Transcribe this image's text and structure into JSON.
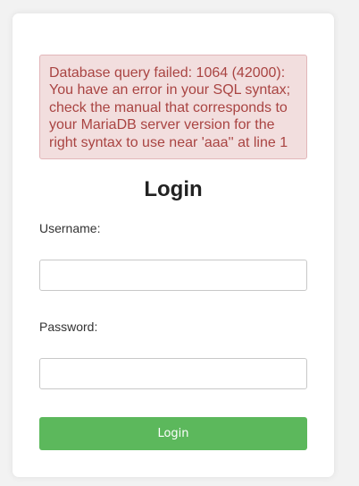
{
  "error_message": "Database query failed: 1064 (42000): You have an error in your SQL syntax; check the manual that corresponds to your MariaDB server version for the right syntax to use near 'aaa'' at line 1",
  "form": {
    "title": "Login",
    "username_label": "Username:",
    "username_value": "",
    "password_label": "Password:",
    "password_value": "",
    "submit_label": "Login"
  },
  "colors": {
    "error_background": "#f2dede",
    "error_text": "#a94442",
    "submit_button": "#5cb85c"
  }
}
